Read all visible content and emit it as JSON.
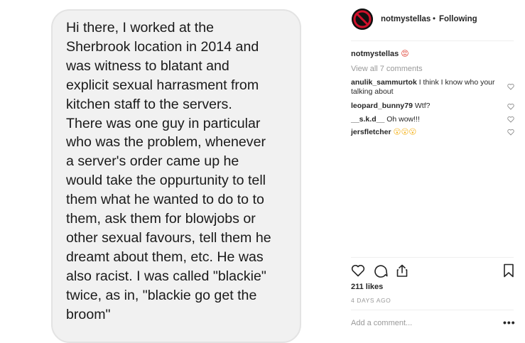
{
  "post_image": {
    "text": "Hi there, I worked at the\nSherbrook location in 2014 and\nwas witness to blatant and\nexplicit sexual harrasment from\nkitchen staff to the servers.\nThere was one guy in particular\nwho was the problem, whenever\na server's order came up he\nwould take the oppurtunity to tell\nthem what he wanted to do to to\nthem, ask them for blowjobs or\nother sexual favours, tell them he\ndreamt about them, etc. He was\nalso racist. I was called \"blackie\"\ntwice, as in, \"blackie go get the\nbroom\""
  },
  "header": {
    "username": "notmystellas",
    "separator": "•",
    "follow_status": "Following",
    "avatar_icon": "no-sign-logo-icon"
  },
  "caption": {
    "username": "notmystellas",
    "emoji": "😡"
  },
  "view_all_comments": "View all 7 comments",
  "comments": [
    {
      "username": "anulik_sammurtok",
      "text": " I think I know who your talking about"
    },
    {
      "username": "leopard_bunny79",
      "text": " Wtf?"
    },
    {
      "username": "__s.k.d__",
      "text": " Oh wow!!!"
    },
    {
      "username": "jersfletcher",
      "text": " 😮😮😮"
    }
  ],
  "likes": "211 likes",
  "date": "4 DAYS AGO",
  "add_comment_placeholder": "Add a comment...",
  "more_options": "•••",
  "colors": {
    "bubble_bg": "#f1f1f1",
    "text_primary": "#262626",
    "text_secondary": "#999999",
    "emoji_face": "#f5b82e"
  }
}
